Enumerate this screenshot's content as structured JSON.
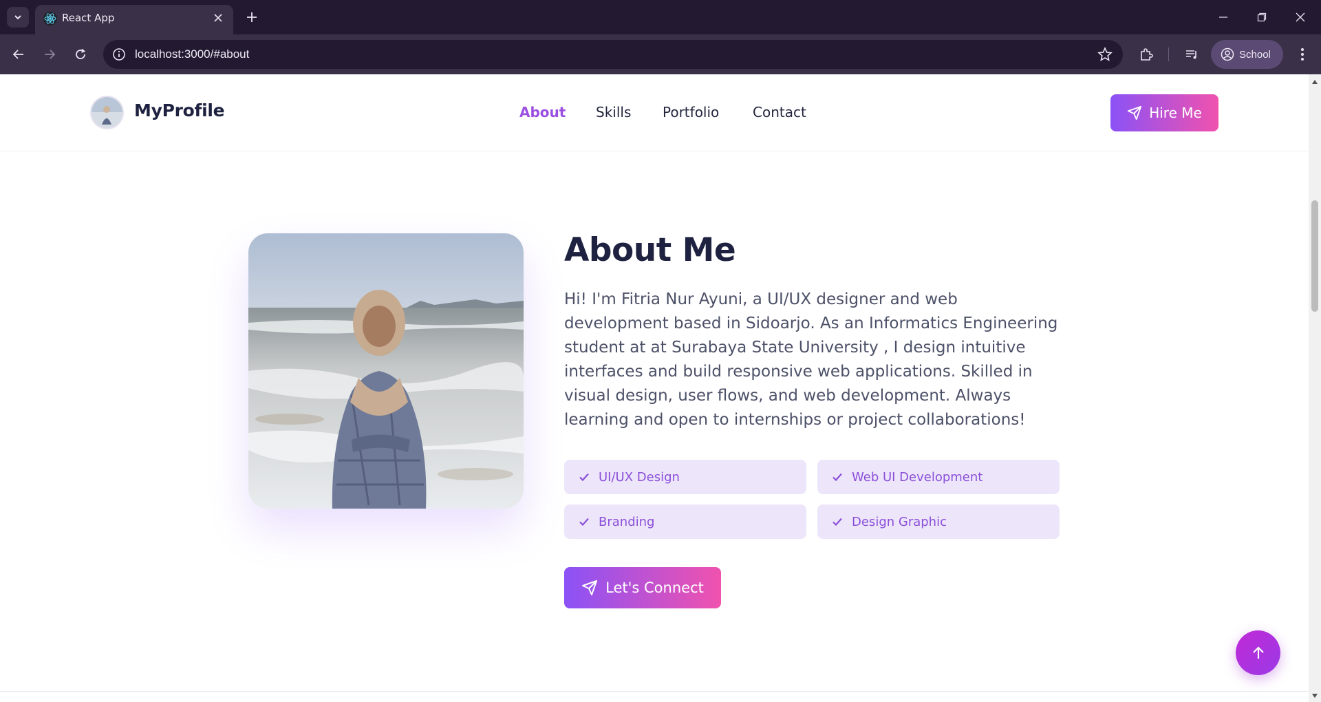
{
  "browser": {
    "tab_title": "React App",
    "url": "localhost:3000/#about",
    "profile_label": "School"
  },
  "header": {
    "logo_text": "MyProfile",
    "nav": [
      {
        "label": "About",
        "active": true
      },
      {
        "label": "Skills",
        "active": false
      },
      {
        "label": "Portfolio",
        "active": false
      },
      {
        "label": "Contact",
        "active": false
      }
    ],
    "hire_label": "Hire Me"
  },
  "about": {
    "title": "About Me",
    "body": "Hi! I'm Fitria Nur Ayuni, a UI/UX designer and web development based in Sidoarjo. As an Informatics Engineering student at at Surabaya State University , I design intuitive interfaces and build responsive web applications. Skilled in visual design, user flows, and web development. Always learning and open to internships or project collaborations!",
    "skills": [
      "UI/UX Design",
      "Web UI Development",
      "Branding",
      "Design Graphic"
    ],
    "connect_label": "Let's Connect"
  },
  "colors": {
    "accent_purple": "#8b52f6",
    "accent_pink": "#f052ae",
    "chip_bg": "#ede6fb",
    "chrome_dark": "#231a31",
    "chrome_toolbar": "#3a3048"
  }
}
